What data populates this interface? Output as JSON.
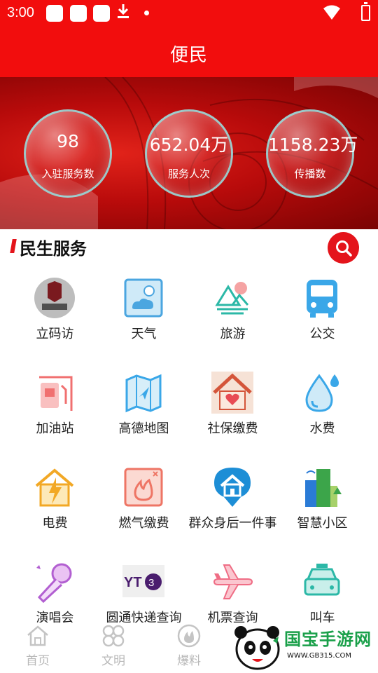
{
  "status_bar": {
    "time": "3:00"
  },
  "header": {
    "title": "便民"
  },
  "stats": [
    {
      "value": "98",
      "label": "入驻服务数"
    },
    {
      "value": "652.04万",
      "label": "服务人次"
    },
    {
      "value": "1158.23万",
      "label": "传播数"
    }
  ],
  "section": {
    "title": "民生服务"
  },
  "services": [
    {
      "label": "立码访",
      "icon": "lima-fang-logo-icon"
    },
    {
      "label": "天气",
      "icon": "weather-icon"
    },
    {
      "label": "旅游",
      "icon": "travel-icon"
    },
    {
      "label": "公交",
      "icon": "bus-icon"
    },
    {
      "label": "加油站",
      "icon": "gas-station-icon"
    },
    {
      "label": "高德地图",
      "icon": "map-icon"
    },
    {
      "label": "社保缴费",
      "icon": "social-security-icon"
    },
    {
      "label": "水费",
      "icon": "water-drop-icon"
    },
    {
      "label": "电费",
      "icon": "electricity-icon"
    },
    {
      "label": "燃气缴费",
      "icon": "gas-flame-icon"
    },
    {
      "label": "群众身后一件事",
      "icon": "house-pin-icon"
    },
    {
      "label": "智慧小区",
      "icon": "smart-community-icon"
    },
    {
      "label": "演唱会",
      "icon": "microphone-icon"
    },
    {
      "label": "圆通快递查询",
      "icon": "yto-logo-icon"
    },
    {
      "label": "机票查询",
      "icon": "airplane-icon"
    },
    {
      "label": "叫车",
      "icon": "taxi-icon"
    }
  ],
  "bottom_nav": [
    {
      "label": "首页",
      "icon": "home-icon"
    },
    {
      "label": "文明",
      "icon": "flower-icon"
    },
    {
      "label": "爆料",
      "icon": "fire-icon"
    }
  ],
  "watermark": {
    "logo_text": "国宝手游网",
    "url": "WWW.GB315.COM"
  },
  "colors": {
    "brand_red": "#f20d0d",
    "accent_red": "#e4141b",
    "nav_inactive": "#b8b8b8",
    "watermark_green": "#1aa04a"
  }
}
